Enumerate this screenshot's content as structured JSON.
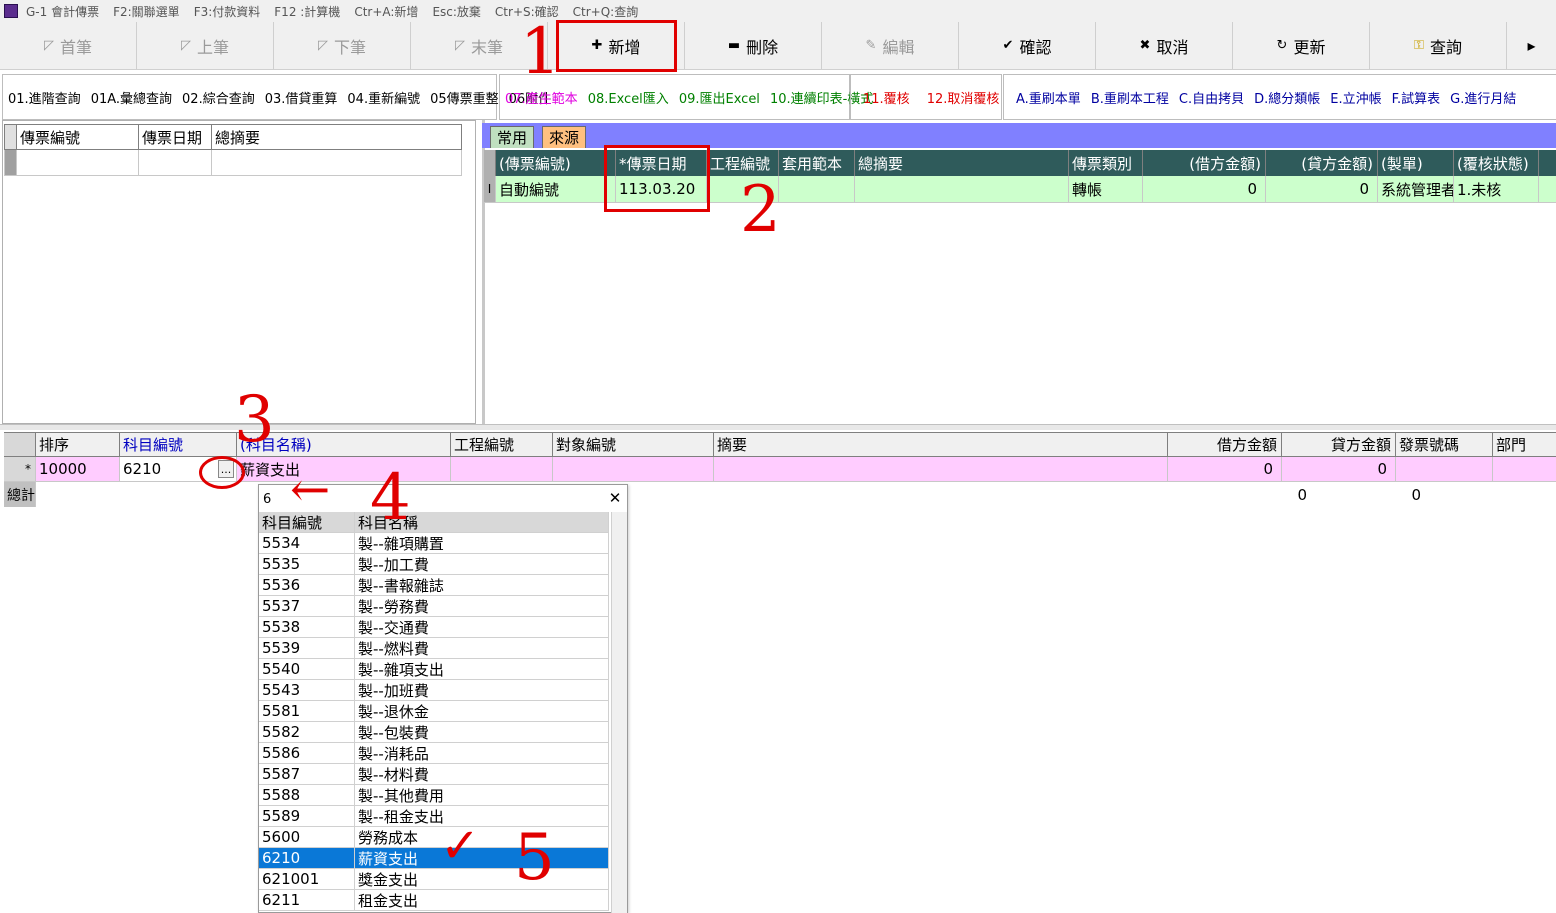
{
  "titlebar": {
    "app": "G-1 會計傳票",
    "hints": [
      "F2:關聯選單",
      "F3:付款資料",
      "F12 :計算機",
      "Ctr+A:新增",
      "Esc:放棄",
      "Ctr+S:確認",
      "Ctr+Q:查詢"
    ]
  },
  "toolbar": {
    "first": "首筆",
    "prev": "上筆",
    "next": "下筆",
    "last": "末筆",
    "add": "新增",
    "delete": "刪除",
    "edit": "編輯",
    "confirm": "確認",
    "cancel": "取消",
    "refresh": "更新",
    "query": "查詢"
  },
  "funcbar": {
    "group1": [
      "01.進階查詢",
      "01A.彙總查詢",
      "02.綜合查詢",
      "03.借貸重算",
      "04.重新編號",
      "05傳票重整",
      "06附件"
    ],
    "group2a": [
      "07.產生範本"
    ],
    "group2b": [
      "08.Excel匯入",
      "09.匯出Excel",
      "10.連續印表-橫式"
    ],
    "group3": [
      "11.覆核",
      "12.取消覆核"
    ],
    "group4": [
      "A.重刷本單",
      "B.重刷本工程",
      "C.自由拷貝",
      "D.總分類帳",
      "E.立沖帳",
      "F.試算表",
      "G.進行月結"
    ]
  },
  "colors": {
    "accent_red": "#e00000",
    "header_teal": "#2f5b5b",
    "row_green": "#ccffcc",
    "row_pink": "#ffccff",
    "selected_blue": "#0a78d7"
  },
  "left_grid": {
    "headers": [
      "傳票編號",
      "傳票日期",
      "總摘要"
    ]
  },
  "tabs": {
    "common": "常用",
    "source": "來源"
  },
  "voucher_grid": {
    "headers": [
      "(傳票編號)",
      "*傳票日期",
      "工程編號",
      "套用範本",
      "總摘要",
      "傳票類別",
      "(借方金額)",
      "(貸方金額)",
      "(製單)",
      "(覆核狀態)"
    ],
    "row": {
      "marker": "I",
      "voucher_no": "自動編號",
      "date": "113.03.20",
      "project": "",
      "template": "",
      "summary": "",
      "type": "轉帳",
      "debit": "0",
      "credit": "0",
      "maker": "系統管理者",
      "status": "1.未核"
    }
  },
  "detail_grid": {
    "headers": [
      "排序",
      "科目編號",
      "(科目名稱)",
      "工程編號",
      "對象編號",
      "摘要",
      "借方金額",
      "貸方金額",
      "發票號碼",
      "部門"
    ],
    "row": {
      "marker": "*",
      "seq": "10000",
      "account_no": "6210",
      "ellipsis": "...",
      "account_name": "薪資支出",
      "debit": "0",
      "credit": "0"
    },
    "total": {
      "label": "總計",
      "debit": "0",
      "credit": "0"
    }
  },
  "popup": {
    "search": "6",
    "close": "✕",
    "headers": [
      "科目編號",
      "科目名稱"
    ],
    "rows": [
      {
        "no": "5534",
        "name": "製--雜項購置"
      },
      {
        "no": "5535",
        "name": "製--加工費"
      },
      {
        "no": "5536",
        "name": "製--書報雜誌"
      },
      {
        "no": "5537",
        "name": "製--勞務費"
      },
      {
        "no": "5538",
        "name": "製--交通費"
      },
      {
        "no": "5539",
        "name": "製--燃料費"
      },
      {
        "no": "5540",
        "name": "製--雜項支出"
      },
      {
        "no": "5543",
        "name": "製--加班費"
      },
      {
        "no": "5581",
        "name": "製--退休金"
      },
      {
        "no": "5582",
        "name": "製--包裝費"
      },
      {
        "no": "5586",
        "name": "製--消耗品"
      },
      {
        "no": "5587",
        "name": "製--材料費"
      },
      {
        "no": "5588",
        "name": "製--其他費用"
      },
      {
        "no": "5589",
        "name": "製--租金支出"
      },
      {
        "no": "5600",
        "name": "勞務成本"
      },
      {
        "no": "6210",
        "name": "薪資支出"
      },
      {
        "no": "621001",
        "name": "獎金支出"
      },
      {
        "no": "6211",
        "name": "租金支出"
      }
    ],
    "selected_index": 15
  },
  "annotations": {
    "n1": "1",
    "n2": "2",
    "n3": "3",
    "n4": "4",
    "n5": "5",
    "check": "✓",
    "arrow": "←"
  }
}
